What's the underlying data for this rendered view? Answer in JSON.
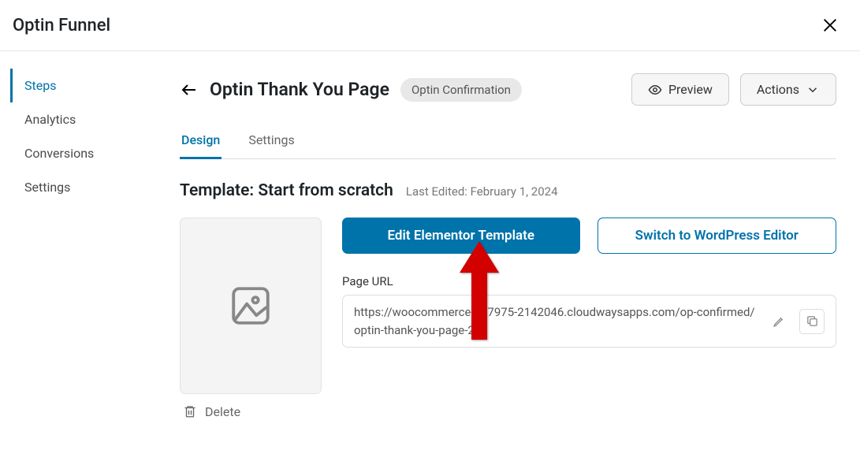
{
  "modal": {
    "title": "Optin Funnel"
  },
  "sidebar": {
    "items": [
      {
        "label": "Steps",
        "active": true
      },
      {
        "label": "Analytics",
        "active": false
      },
      {
        "label": "Conversions",
        "active": false
      },
      {
        "label": "Settings",
        "active": false
      }
    ]
  },
  "page": {
    "title": "Optin Thank You Page",
    "badge": "Optin Confirmation",
    "preview_label": "Preview",
    "actions_label": "Actions"
  },
  "tabs": [
    {
      "label": "Design",
      "active": true
    },
    {
      "label": "Settings",
      "active": false
    }
  ],
  "template": {
    "title": "Template: Start from scratch",
    "last_edited": "Last Edited: February 1, 2024",
    "delete_label": "Delete",
    "edit_elementor_label": "Edit Elementor Template",
    "switch_editor_label": "Switch to WordPress Editor",
    "url_label": "Page URL",
    "url_value": "https://woocommerce-547975-2142046.cloudwaysapps.com/op-confirmed/optin-thank-you-page-2"
  }
}
